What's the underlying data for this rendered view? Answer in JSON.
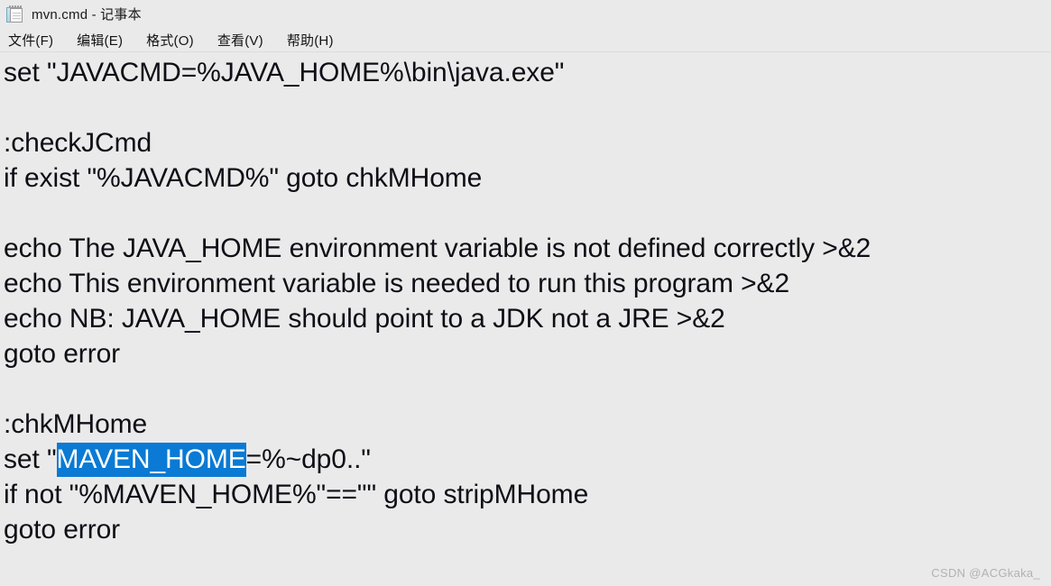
{
  "window": {
    "title": "mvn.cmd - 记事本",
    "icon": "notepad-icon",
    "background_color": "#eaeaea"
  },
  "menubar": {
    "items": [
      {
        "label": "文件(F)",
        "name": "file"
      },
      {
        "label": "编辑(E)",
        "name": "edit"
      },
      {
        "label": "格式(O)",
        "name": "format"
      },
      {
        "label": "查看(V)",
        "name": "view"
      },
      {
        "label": "帮助(H)",
        "name": "help"
      }
    ]
  },
  "editor": {
    "selection_color": "#0a7ad4",
    "selection_text_color": "#ffffff",
    "text_color": "#0e0e16",
    "lines": [
      {
        "text": "set \"JAVACMD=%JAVA_HOME%\\bin\\java.exe\""
      },
      {
        "text": ""
      },
      {
        "text": ":checkJCmd"
      },
      {
        "text": "if exist \"%JAVACMD%\" goto chkMHome"
      },
      {
        "text": ""
      },
      {
        "text": "echo The JAVA_HOME environment variable is not defined correctly >&2"
      },
      {
        "text": "echo This environment variable is needed to run this program >&2"
      },
      {
        "text": "echo NB: JAVA_HOME should point to a JDK not a JRE >&2"
      },
      {
        "text": "goto error"
      },
      {
        "text": ""
      },
      {
        "text": ":chkMHome"
      },
      {
        "text": "",
        "parts": [
          {
            "text": "set \"",
            "selected": false
          },
          {
            "text": "MAVEN_HOME",
            "selected": true
          },
          {
            "text": "=%~dp0..\"",
            "selected": false
          }
        ]
      },
      {
        "text": "if not \"%MAVEN_HOME%\"==\"\" goto stripMHome"
      },
      {
        "text": "goto error"
      }
    ]
  },
  "watermark": {
    "text": "CSDN @ACGkaka_"
  }
}
